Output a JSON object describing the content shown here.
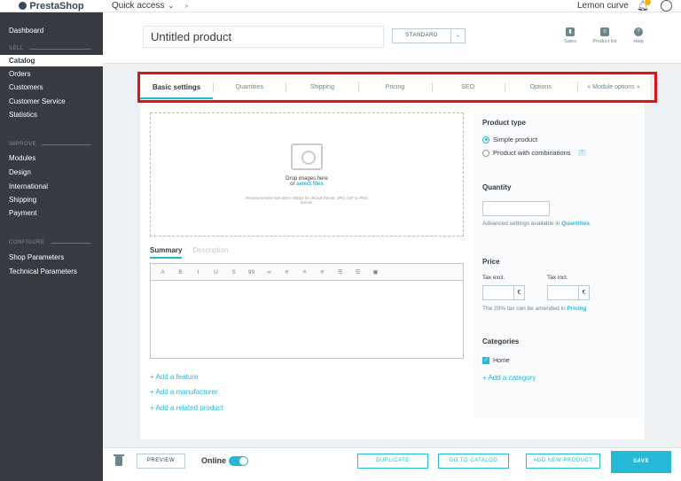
{
  "topbar": {
    "logo": "PrestaShop",
    "quick_access": "Quick access",
    "shop_name": "Lemon curve"
  },
  "sidebar": {
    "dashboard": "Dashboard",
    "sell": "SELL",
    "catalog": "Catalog",
    "orders": "Orders",
    "customers": "Customers",
    "customer_service": "Customer Service",
    "statistics": "Statistics",
    "improve": "IMPROVE",
    "modules": "Modules",
    "design": "Design",
    "international": "International",
    "shipping": "Shipping",
    "payment": "Payment",
    "configure": "CONFIGURE",
    "shop_parameters": "Shop Parameters",
    "technical_parameters": "Technical Parameters"
  },
  "header": {
    "product_name": "Untitled product",
    "product_type_select": "STANDARD",
    "sales": "Sales",
    "product_list": "Product list",
    "help": "Help"
  },
  "tabs": [
    "Basic settings",
    "Quantities",
    "Shipping",
    "Pricing",
    "SEO",
    "Options",
    "« Module options »"
  ],
  "dropzone": {
    "title": "Drop images here",
    "or": "or",
    "select": "select files",
    "note": "Recommended size 800 x 800px for default theme. JPG, GIF or PNG format."
  },
  "summary": {
    "summary_tab": "Summary",
    "description_tab": "Description",
    "toolbar": [
      "A",
      "B",
      "I",
      "U",
      "S",
      "99",
      "∞",
      "≡",
      "≡",
      "≡",
      "☰",
      "☰",
      "▣"
    ]
  },
  "links": {
    "feature": "+ Add a feature",
    "manufacturer": "+ Add a manufacturer",
    "related": "+ Add a related product"
  },
  "right": {
    "product_type": "Product type",
    "simple": "Simple product",
    "combinations": "Product with combinations",
    "quantity": "Quantity",
    "qty_note_prefix": "Advanced settings available in",
    "qty_note_link": "Quantities",
    "price": "Price",
    "tax_excl": "Tax excl.",
    "tax_incl": "Tax incl.",
    "currency": "€",
    "price_note_prefix": "The 20% tax can be amended in",
    "price_note_link": "Pricing",
    "categories": "Categories",
    "home": "Home",
    "add_category": "+ Add a category"
  },
  "footer": {
    "preview": "PREVIEW",
    "online": "Online",
    "duplicate": "DUPLICATE",
    "go_to_catalog": "GO TO CATALOG",
    "add_new": "ADD NEW PRODUCT",
    "save": "SAVE"
  }
}
